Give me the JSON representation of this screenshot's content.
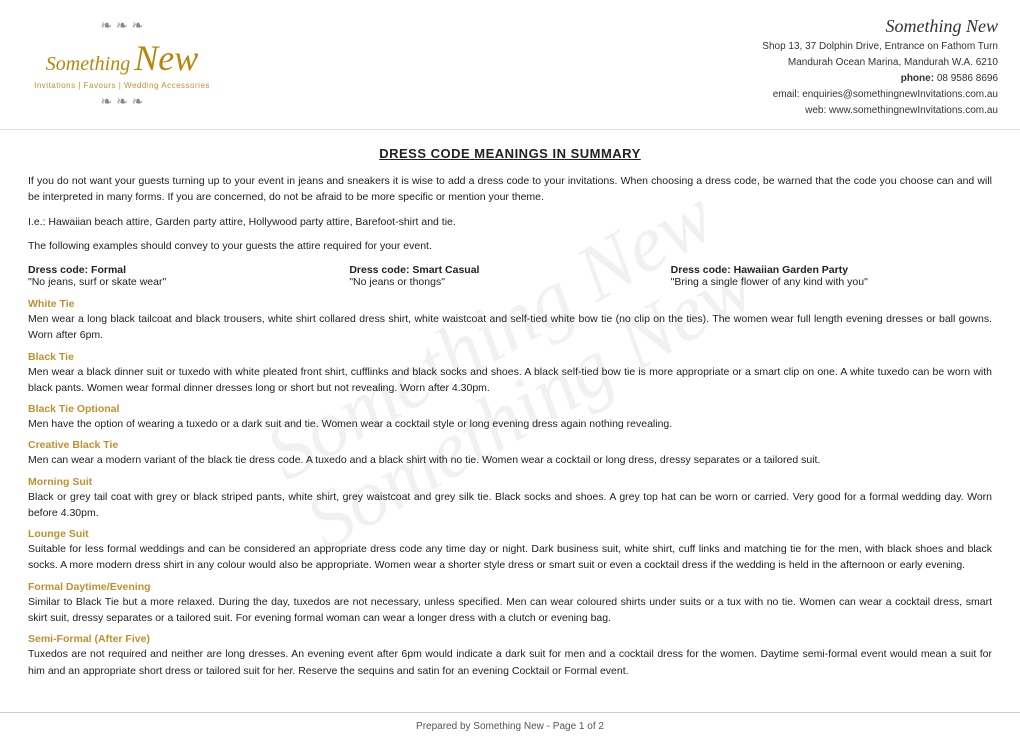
{
  "header": {
    "logo_s": "Something",
    "logo_new": "New",
    "logo_ornament_top": "❧❧❧",
    "logo_ornament_bottom": "❧❧❧",
    "tagline": "Invitations | Favours | Wedding Accessories",
    "brand_script": "Something New",
    "address_line1": "Shop 13, 37 Dolphin Drive, Entrance on Fathom Turn",
    "address_line2": "Mandurah Ocean Marina, Mandurah W.A.  6210",
    "phone_label": "phone:",
    "phone_number": "08 9586 8696",
    "email_label": "email:",
    "email_address": "enquiries@somethingnewInvitations.com.au",
    "web_label": "web:",
    "web_address": "www.somethingnewInvitations.com.au"
  },
  "watermark": {
    "line1": "Something New",
    "line2": "Something New"
  },
  "main_title": "DRESS CODE MEANINGS IN SUMMARY",
  "intro": {
    "para1": "If you do not want your guests turning up to your event in jeans and sneakers it is wise to add a dress code to your invitations. When choosing a dress code, be warned that the code you choose can and will be interpreted in many forms. If you are concerned, do not be afraid to be more specific or mention your theme.",
    "para2": "I.e.: Hawaiian beach attire, Garden party attire, Hollywood party attire, Barefoot-shirt and tie.",
    "para3": "The following examples should convey to your guests the attire required for your event."
  },
  "dress_codes": [
    {
      "label": "Dress code: Formal",
      "quote": "\"No jeans, surf or skate wear\""
    },
    {
      "label": "Dress code: Smart Casual",
      "quote": "\"No jeans or thongs\""
    },
    {
      "label": "Dress code: Hawaiian Garden Party",
      "quote": "\"Bring a single flower of any kind with you\""
    }
  ],
  "sections": [
    {
      "id": "white-tie",
      "title": "White Tie",
      "body": "Men wear a long black tailcoat and black trousers, white shirt collared dress shirt, white waistcoat and self-tied white bow tie (no clip on the ties). The women wear full length evening dresses or ball gowns. Worn after 6pm."
    },
    {
      "id": "black-tie",
      "title": "Black Tie",
      "body": "Men wear a black dinner suit or tuxedo with white pleated front shirt, cufflinks and black socks and shoes. A black self-tied bow tie is more appropriate or a smart clip on one. A white tuxedo can be worn with black pants. Women wear formal dinner dresses long or short but not revealing. Worn after 4.30pm."
    },
    {
      "id": "black-tie-optional",
      "title": "Black Tie Optional",
      "body": "Men have the option of wearing a tuxedo or a dark suit and tie. Women wear a cocktail style or long evening dress again nothing revealing."
    },
    {
      "id": "creative-black-tie",
      "title": "Creative Black Tie",
      "body": "Men can wear a modern variant of the black tie dress code. A tuxedo and a black shirt with no tie. Women wear a cocktail or long dress, dressy separates or a tailored suit."
    },
    {
      "id": "morning-suit",
      "title": "Morning Suit",
      "body": "Black or grey tail coat with grey or black striped pants, white shirt, grey waistcoat and grey silk tie. Black socks and shoes. A grey top hat can be worn or carried. Very good for a formal wedding day. Worn before 4.30pm."
    },
    {
      "id": "lounge-suit",
      "title": "Lounge Suit",
      "body": "Suitable for less formal weddings and can be considered an appropriate dress code any time day or night. Dark business suit, white shirt, cuff links and matching tie for the men, with black shoes and black socks. A more modern dress shirt in any colour would also be appropriate. Women wear a shorter style dress or smart suit or even a cocktail dress if the wedding is held in the afternoon or early evening."
    },
    {
      "id": "formal-daytime-evening",
      "title": "Formal Daytime/Evening",
      "body": "Similar to Black Tie but a more relaxed. During the day, tuxedos are not necessary, unless specified. Men can wear coloured shirts under suits or a tux with no tie. Women can wear a cocktail dress, smart skirt suit, dressy separates or a tailored suit. For evening formal woman can wear a longer dress with a clutch or evening bag."
    },
    {
      "id": "semi-formal",
      "title": "Semi-Formal (After Five)",
      "body": "Tuxedos are not required and neither are long dresses. An evening event after 6pm would indicate a dark suit for men and a cocktail dress for the women. Daytime semi-formal event would mean a suit for him and an appropriate short dress or tailored suit for her. Reserve the sequins and satin for an evening Cocktail or Formal event."
    }
  ],
  "footer": {
    "text": "Prepared by Something New - Page 1 of 2"
  }
}
